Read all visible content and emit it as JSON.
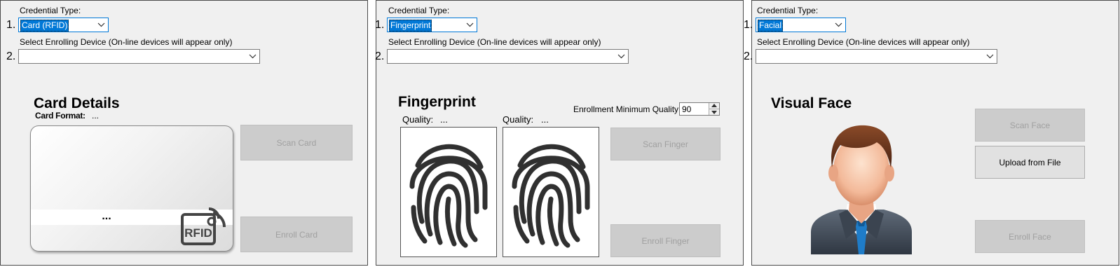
{
  "card": {
    "step1_number": "1.",
    "credential_type_label": "Credential Type:",
    "credential_type_value": "Card (RFID)",
    "step2_number": "2.",
    "device_label": "Select Enrolling Device (On-line devices will appear only)",
    "device_value": "",
    "section_title": "Card Details",
    "card_format_label": "Card Format:",
    "card_format_value": "...",
    "card_number": "...",
    "rfid_logo_text": "RFID",
    "scan_button": "Scan Card",
    "enroll_button": "Enroll Card"
  },
  "fingerprint": {
    "step1_number": "1.",
    "credential_type_label": "Credential Type:",
    "credential_type_value": "Fingerprint",
    "step2_number": "2.",
    "device_label": "Select Enrolling Device (On-line devices will appear only)",
    "device_value": "",
    "section_title": "Fingerprint",
    "min_quality_label": "Enrollment Minimum Quality :",
    "min_quality_value": "90",
    "quality_left_label": "Quality:",
    "quality_left_value": "...",
    "quality_right_label": "Quality:",
    "quality_right_value": "...",
    "scan_button": "Scan Finger",
    "enroll_button": "Enroll Finger"
  },
  "face": {
    "step1_number": "1.",
    "credential_type_label": "Credential Type:",
    "credential_type_value": "Facial",
    "step2_number": "2.",
    "device_label": "Select Enrolling Device (On-line devices will appear only)",
    "device_value": "",
    "section_title": "Visual Face",
    "scan_button": "Scan Face",
    "upload_button": "Upload from File",
    "enroll_button": "Enroll Face"
  },
  "colors": {
    "panel_bg": "#f0f0f0",
    "selection_blue": "#0078d7",
    "disabled_button": "#cccccc",
    "disabled_text": "#a0a0a0",
    "enabled_button": "#e1e1e1"
  }
}
